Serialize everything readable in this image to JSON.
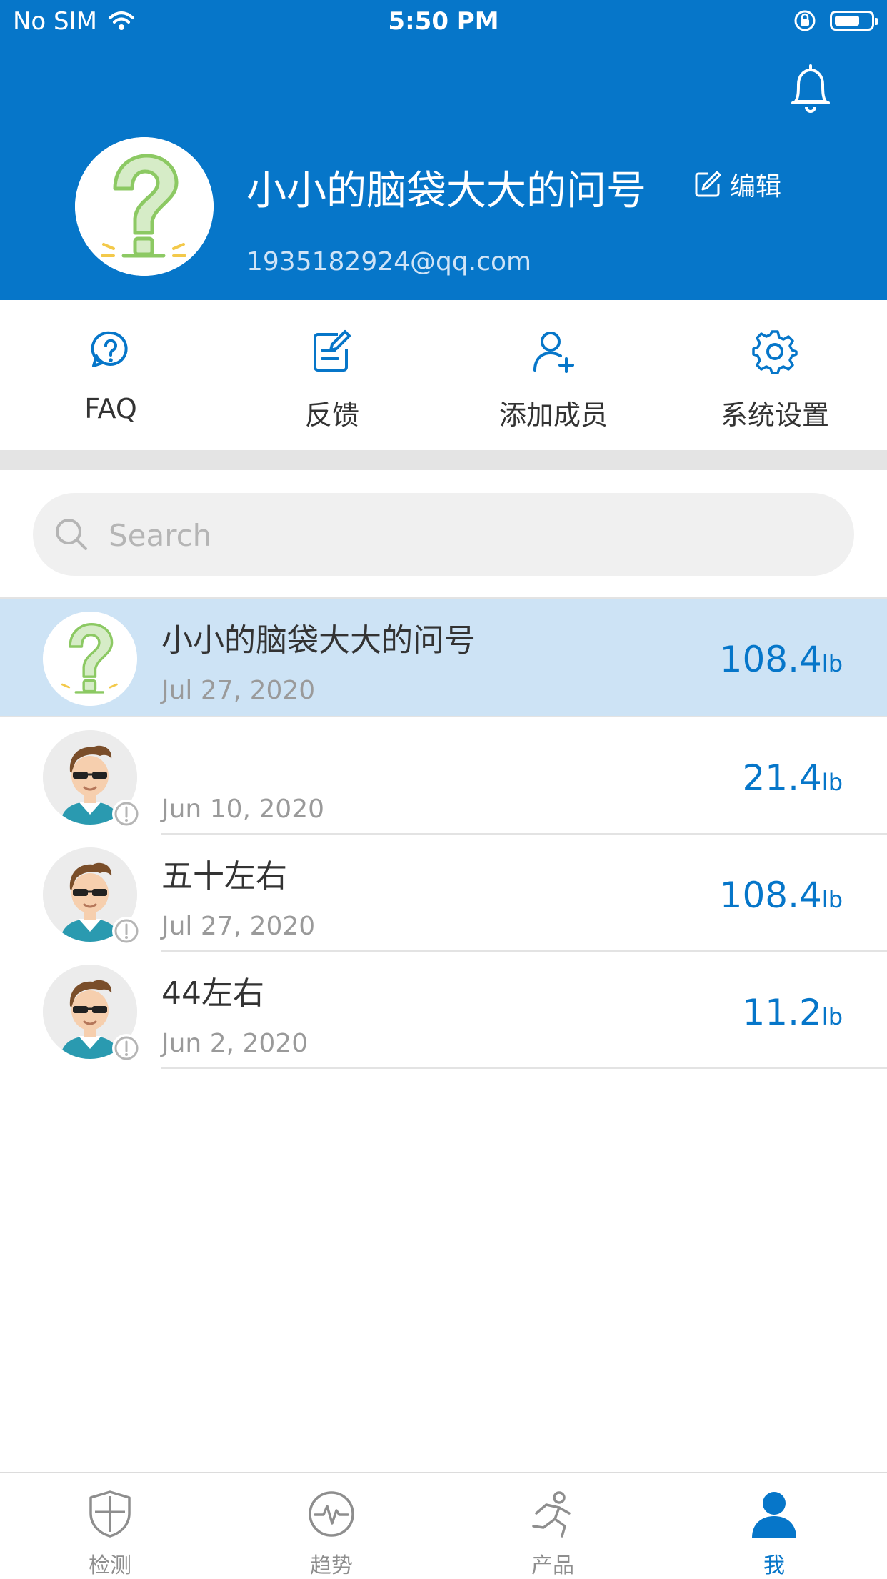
{
  "status_bar": {
    "carrier": "No SIM",
    "time": "5:50 PM"
  },
  "profile": {
    "name": "小小的脑袋大大的问号",
    "edit_label": "编辑",
    "email": "1935182924@qq.com"
  },
  "actions": [
    {
      "label": "FAQ",
      "icon": "faq-icon"
    },
    {
      "label": "反馈",
      "icon": "feedback-icon"
    },
    {
      "label": "添加成员",
      "icon": "add-member-icon"
    },
    {
      "label": "系统设置",
      "icon": "settings-icon"
    }
  ],
  "search": {
    "placeholder": "Search"
  },
  "members": [
    {
      "name": "小小的脑袋大大的问号",
      "date": "Jul 27, 2020",
      "value": "108.4",
      "unit": "lb",
      "avatar": "question-mark-avatar",
      "selected": true
    },
    {
      "name": "",
      "date": "Jun 10, 2020",
      "value": "21.4",
      "unit": "lb",
      "avatar": "boy-avatar"
    },
    {
      "name": "五十左右",
      "date": "Jul 27, 2020",
      "value": "108.4",
      "unit": "lb",
      "avatar": "boy-avatar"
    },
    {
      "name": "44左右",
      "date": "Jun 2, 2020",
      "value": "11.2",
      "unit": "lb",
      "avatar": "boy-avatar"
    }
  ],
  "tabs": [
    {
      "label": "检测",
      "icon": "shield-icon"
    },
    {
      "label": "趋势",
      "icon": "pulse-icon"
    },
    {
      "label": "产品",
      "icon": "runner-icon"
    },
    {
      "label": "我",
      "icon": "person-icon",
      "active": true
    }
  ],
  "colors": {
    "brand": "#0676c9",
    "selected_row": "#cde3f5"
  }
}
